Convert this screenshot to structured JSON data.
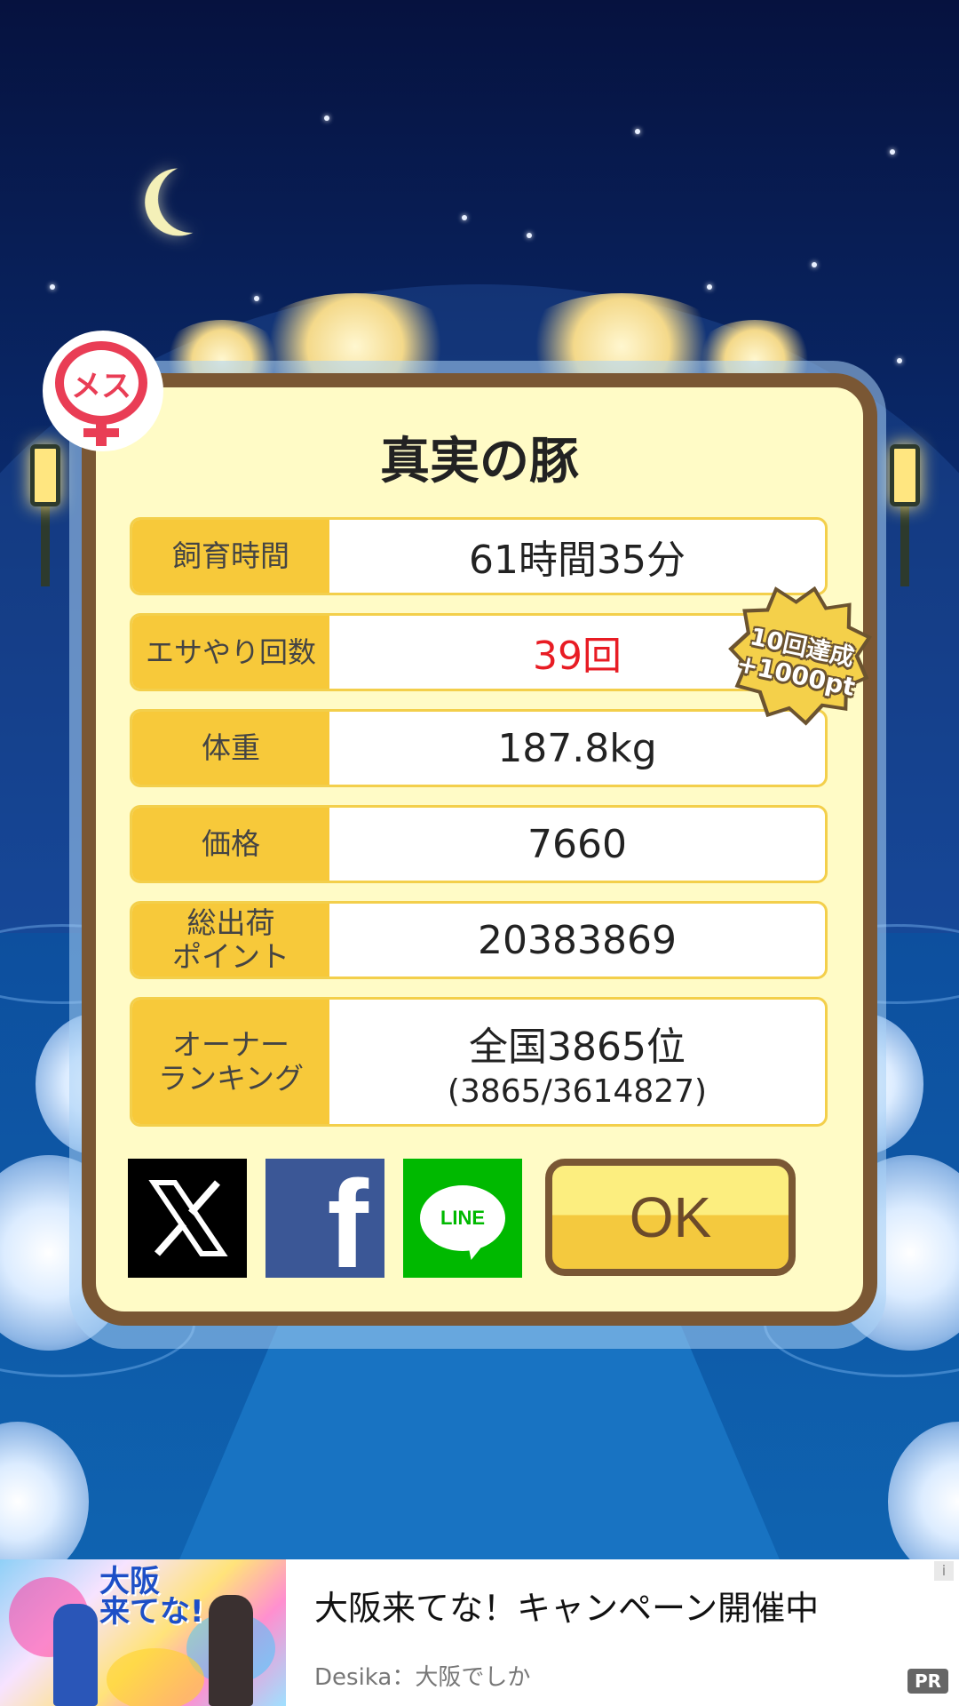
{
  "pig": {
    "gender_label": "メス",
    "name": "真実の豚"
  },
  "stats": [
    {
      "label": "飼育時間",
      "value": "61時間35分"
    },
    {
      "label": "エサやり回数",
      "value": "39回"
    },
    {
      "label": "体重",
      "value": "187.8kg"
    },
    {
      "label": "価格",
      "value": "7660"
    },
    {
      "label": "総出荷\nポイント",
      "value": "20383869"
    },
    {
      "label": "オーナー\nランキング",
      "value": "全国3865位",
      "sub": "(3865/3614827)"
    }
  ],
  "achievement": {
    "line1": "10回達成",
    "line2": "+1000pt"
  },
  "share": {
    "x_icon": "x-logo-icon",
    "facebook_icon": "facebook-logo-icon",
    "line_label": "LINE"
  },
  "ok_button": "OK",
  "ad": {
    "title": "大阪来てな！キャンペーン開催中",
    "advertiser": "Desika：大阪でしか",
    "image_logo": "大阪\n来てな!",
    "pr_badge": "PR",
    "info_icon": "i"
  },
  "colors": {
    "accent_yellow": "#f7c93a",
    "frame_brown": "#7a5734",
    "highlight_red": "#e81c24",
    "female_red": "#e93d55"
  }
}
